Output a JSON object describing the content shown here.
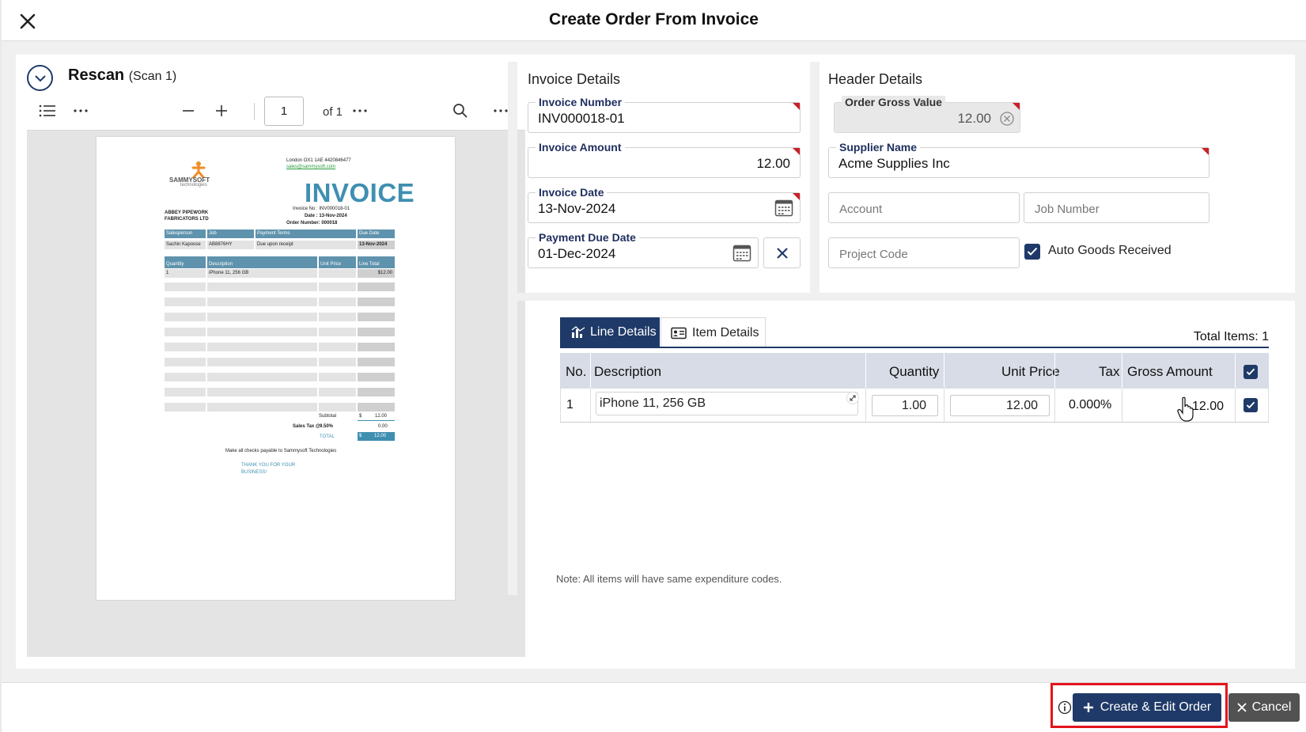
{
  "dialog": {
    "title": "Create Order From Invoice"
  },
  "scan": {
    "title": "Rescan",
    "subtitle": "(Scan 1)"
  },
  "pdf_toolbar": {
    "page_value": "1",
    "page_of": "of 1"
  },
  "invoice_doc": {
    "brand": "SAMMYSOFT",
    "brand_sub": "technologies",
    "address": "London OX1 1AE 4420846477",
    "email": "sales@sammysoft.com",
    "heading": "INVOICE",
    "bill_to_1": "ABBEY PIPEWORK",
    "bill_to_2": "FABRICATORS LTD",
    "invoice_no": "Invoice No : INV000018-01",
    "date": "Date : 13-Nov-2024",
    "order_number": "Order Number: 000018",
    "h_salesperson": "Salesperson",
    "h_job": "Job",
    "h_terms": "Payment Terms",
    "h_due": "Due Date",
    "v_salesperson": "Sachin Kapoose",
    "v_job": "AB8876HY",
    "v_terms": "Due upon receipt",
    "v_due": "13-Nov-2024",
    "h_qty": "Quantity",
    "h_desc": "Description",
    "h_unit": "Unit Price",
    "h_total": "Line Total",
    "v_qty": "1",
    "v_desc": "iPhone 11, 256 GB",
    "v_total": "$12.00",
    "subtotal_label": "Subtotal",
    "subtotal_cur": "$",
    "subtotal_val": "12.00",
    "tax_label": "Sales Tax @",
    "tax_rate": "9.50%",
    "tax_val": "0.00",
    "total_label": "TOTAL",
    "total_cur": "$",
    "total_val": "12.00",
    "checks_note": "Make all checks payable to Sammysoft Technologies",
    "thanks_1": "THANK YOU FOR YOUR",
    "thanks_2": "BUSINESS!"
  },
  "invoice_details": {
    "section_title": "Invoice Details",
    "invoice_number": {
      "label": "Invoice Number",
      "value": "INV000018-01"
    },
    "invoice_amount": {
      "label": "Invoice Amount",
      "value": "12.00"
    },
    "invoice_date": {
      "label": "Invoice Date",
      "value": "13-Nov-2024"
    },
    "payment_due_date": {
      "label": "Payment Due Date",
      "value": "01-Dec-2024"
    }
  },
  "header_details": {
    "section_title": "Header Details",
    "order_gross_value": {
      "label": "Order Gross Value",
      "value": "12.00"
    },
    "supplier_name": {
      "label": "Supplier Name",
      "value": "Acme Supplies Inc"
    },
    "account": {
      "placeholder": "Account"
    },
    "job_number": {
      "placeholder": "Job Number"
    },
    "project_code": {
      "placeholder": "Project Code"
    },
    "auto_goods_received": {
      "label": "Auto Goods Received",
      "checked": true
    }
  },
  "tabs": [
    {
      "label": "Line Details",
      "active": true
    },
    {
      "label": "Item Details",
      "active": false
    }
  ],
  "total_items": "Total Items: 1",
  "grid": {
    "columns": [
      "No.",
      "Description",
      "Quantity",
      "Unit Price",
      "Tax",
      "Gross Amount"
    ],
    "rows": [
      {
        "no": "1",
        "description": "iPhone 11, 256 GB",
        "quantity": "1.00",
        "unit_price": "12.00",
        "tax": "0.000%",
        "gross_amount": "12.00",
        "checked": true
      }
    ]
  },
  "note": "Note: All items will have same expenditure codes.",
  "footer": {
    "create_label": "Create & Edit Order",
    "cancel_label": "Cancel"
  },
  "colors": {
    "primary": "#1f3a68",
    "required": "#c8202a",
    "highlight": "#e3141b",
    "invoice_accent": "#3f8fb1"
  }
}
